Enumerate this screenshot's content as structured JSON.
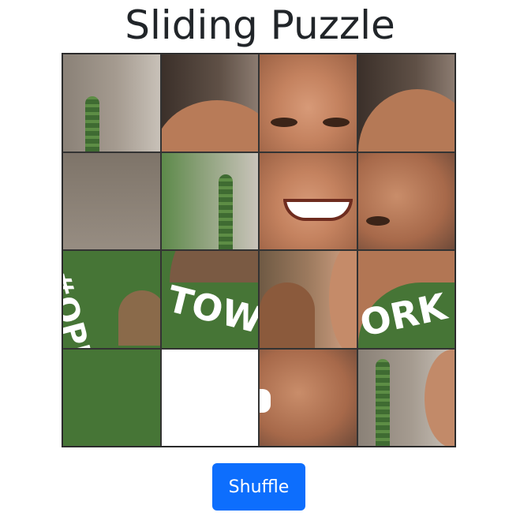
{
  "page": {
    "title": "Sliding Puzzle"
  },
  "board": {
    "rows": 4,
    "cols": 4,
    "empty_tile": {
      "row": 4,
      "col": 2
    },
    "tile_text": {
      "r3c1": "#OPEN",
      "r3c2": "TOWO",
      "r3c4": "ORK"
    }
  },
  "controls": {
    "shuffle_label": "Shuffle"
  },
  "colors": {
    "accent": "#0d6efd",
    "banner_green": "#467536"
  }
}
